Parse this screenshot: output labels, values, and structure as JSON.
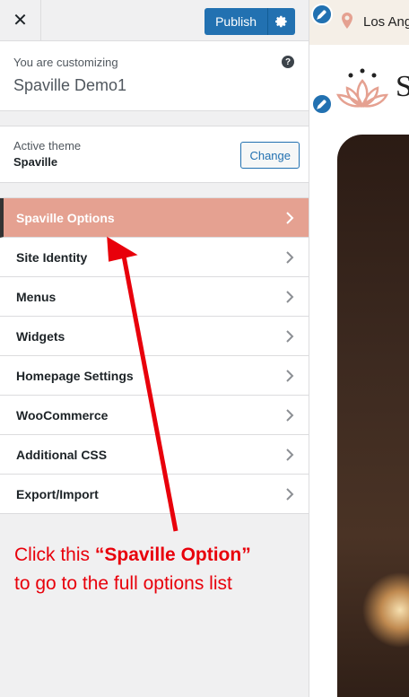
{
  "topbar": {
    "close_label": "✕",
    "publish_label": "Publish"
  },
  "info": {
    "customizing_label": "You are customizing",
    "site_name": "Spaville Demo1",
    "help_label": "?"
  },
  "theme": {
    "active_label": "Active theme",
    "name": "Spaville",
    "change_label": "Change"
  },
  "menu": {
    "items": [
      {
        "label": "Spaville Options",
        "active": true
      },
      {
        "label": "Site Identity"
      },
      {
        "label": "Menus"
      },
      {
        "label": "Widgets"
      },
      {
        "label": "Homepage Settings"
      },
      {
        "label": "WooCommerce"
      },
      {
        "label": "Additional CSS"
      },
      {
        "label": "Export/Import"
      }
    ]
  },
  "preview": {
    "location_text": "Los Ang",
    "logo_letter": "S"
  },
  "annotation": {
    "line1_prefix": "Click this ",
    "line1_bold": "“Spaville Option”",
    "line2": "to go to the full options list"
  },
  "colors": {
    "accent": "#2271b1",
    "active_item": "#e5a191",
    "annotation": "#e8000b"
  }
}
